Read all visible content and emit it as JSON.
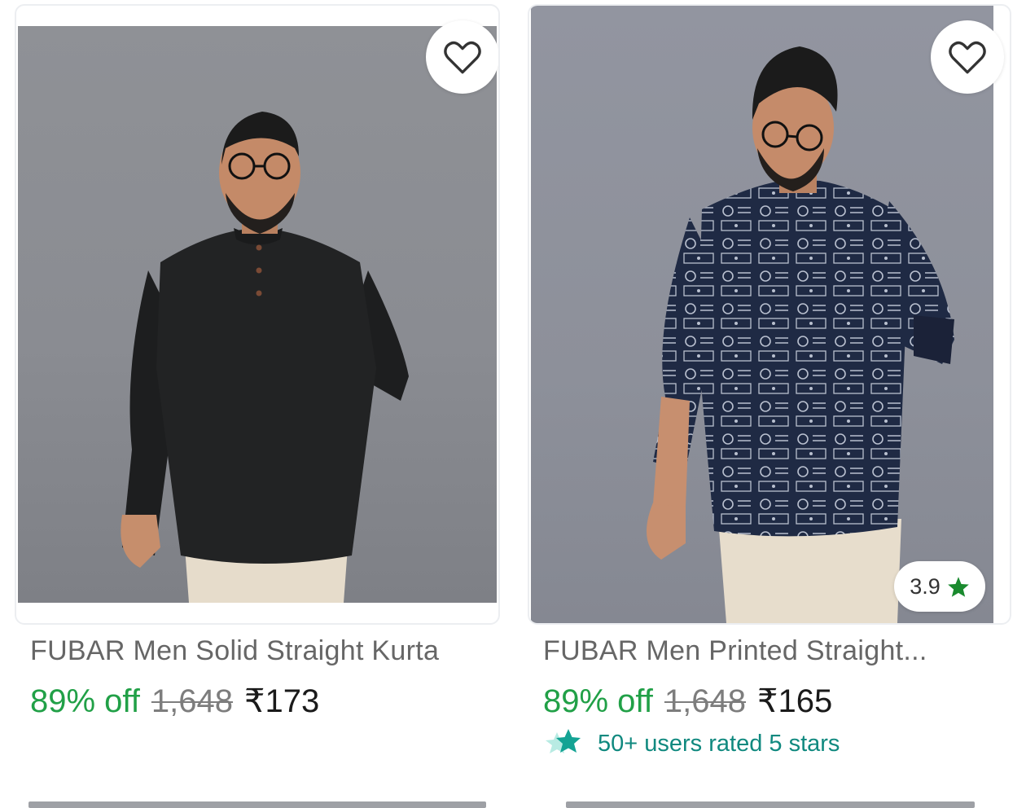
{
  "products": [
    {
      "title": "FUBAR Men Solid Straight Kurta",
      "discount": "89% off",
      "mrp": "1,648",
      "price": "₹173",
      "wishlist_icon": "heart-outline-icon"
    },
    {
      "title": "FUBAR Men Printed Straight...",
      "discount": "89% off",
      "mrp": "1,648",
      "price": "₹165",
      "rating": "3.9",
      "badge": "50+ users rated 5 stars",
      "wishlist_icon": "heart-outline-icon"
    }
  ],
  "colors": {
    "discount": "#21a047",
    "badge": "#10897f",
    "rating_star": "#1a8a2e"
  }
}
